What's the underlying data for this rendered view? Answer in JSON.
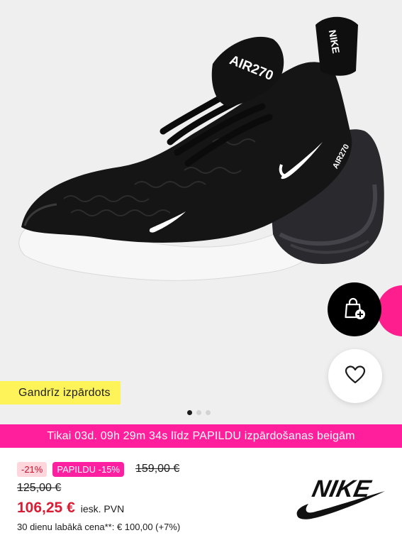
{
  "product": {
    "image_alt": "Nike Air Max 270 sneaker"
  },
  "badges": {
    "low_stock": "Gandrīz izpārdots"
  },
  "gallery": {
    "dots": [
      {
        "active": true
      },
      {
        "active": false
      },
      {
        "active": false
      }
    ]
  },
  "actions": {
    "add_to_bag_icon": "bag-plus-icon",
    "wishlist_icon": "heart-icon"
  },
  "promo": {
    "text": "Tikai 03d. 09h 29m 34s līdz PAPILDU izpārdošanas beigām"
  },
  "pricing": {
    "discount_tag": "-21%",
    "extra_tag": "PAPILDU -15%",
    "original_price": "159,00 €",
    "previous_price": "125,00 €",
    "final_price": "106,25 €",
    "vat_note": "iesk. PVN",
    "lowest_30d": "30 dienu labākā cena**: € 100,00 (+7%)"
  },
  "brand": {
    "name": "NIKE"
  },
  "colors": {
    "promo_pink": "#ff1f9c",
    "sale_red": "#d81d34",
    "low_stock_yellow": "#fff35a"
  }
}
